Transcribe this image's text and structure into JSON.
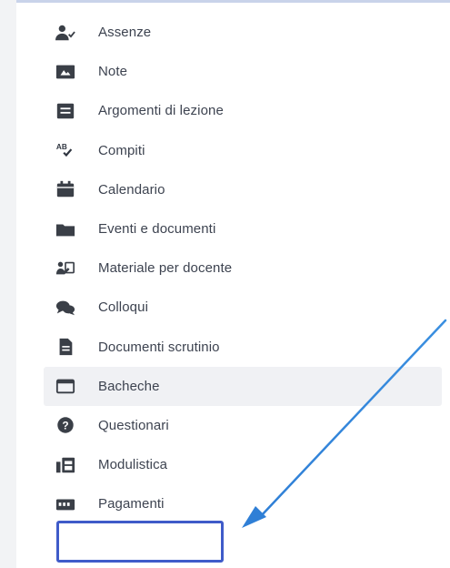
{
  "sidebar": {
    "items": [
      {
        "label": "Assenze",
        "icon": "user-check-icon"
      },
      {
        "label": "Note",
        "icon": "note-icon"
      },
      {
        "label": "Argomenti di lezione",
        "icon": "lesson-board-icon"
      },
      {
        "label": "Compiti",
        "icon": "ab-check-icon"
      },
      {
        "label": "Calendario",
        "icon": "calendar-icon"
      },
      {
        "label": "Eventi e documenti",
        "icon": "folder-icon"
      },
      {
        "label": "Materiale per docente",
        "icon": "teacher-material-icon"
      },
      {
        "label": "Colloqui",
        "icon": "chat-bubbles-icon"
      },
      {
        "label": "Documenti scrutinio",
        "icon": "document-icon"
      },
      {
        "label": "Bacheche",
        "icon": "board-icon",
        "highlighted": true
      },
      {
        "label": "Questionari",
        "icon": "question-circle-icon"
      },
      {
        "label": "Modulistica",
        "icon": "forms-icon"
      },
      {
        "label": "Pagamenti",
        "icon": "payment-card-icon",
        "boxed": true
      }
    ]
  },
  "annotation": {
    "arrow_color": "#2f7fd6",
    "box_color": "#3f5bc9"
  }
}
